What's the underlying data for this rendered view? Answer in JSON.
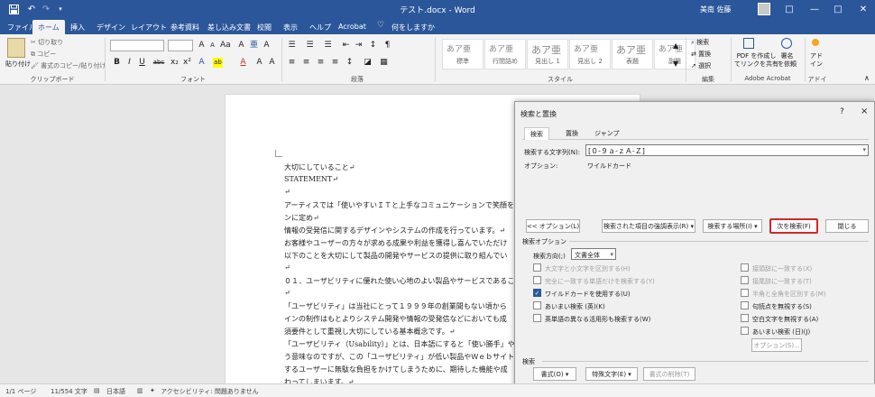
{
  "window": {
    "title": "テスト.docx - Word",
    "user": "美南 佐藤"
  },
  "qat": {
    "save_icon": "save-icon",
    "undo_icon": "undo-icon",
    "redo_icon": "redo-icon",
    "customize_icon": "chevron-down-icon"
  },
  "window_controls": {
    "ribbon_display": "□",
    "minimize": "—",
    "maximize": "□",
    "close": "✕"
  },
  "tabs": [
    {
      "label": "ファイル"
    },
    {
      "label": "ホーム",
      "active": true
    },
    {
      "label": "挿入"
    },
    {
      "label": "デザイン"
    },
    {
      "label": "レイアウト"
    },
    {
      "label": "参考資料"
    },
    {
      "label": "差し込み文書"
    },
    {
      "label": "校閲"
    },
    {
      "label": "表示"
    },
    {
      "label": "ヘルプ"
    },
    {
      "label": "Acrobat"
    },
    {
      "label": "何をしますか"
    }
  ],
  "ribbon": {
    "clipboard": {
      "label": "クリップボード",
      "paste": "貼り付け",
      "cut": "切り取り",
      "copy": "コピー",
      "format_painter": "書式のコピー/貼り付け"
    },
    "font": {
      "label": "フォント",
      "bold": "B",
      "italic": "I",
      "underline": "U",
      "strike": "abc",
      "sub": "x₂",
      "sup": "x²",
      "highlight": "ab",
      "color": "A"
    },
    "paragraph": {
      "label": "段落"
    },
    "styles": {
      "label": "スタイル",
      "items": [
        {
          "preview": "あア亜",
          "name": "標準"
        },
        {
          "preview": "あア亜",
          "name": "行間詰め"
        },
        {
          "preview": "あア亜",
          "name": "見出し 1"
        },
        {
          "preview": "あア亜",
          "name": "見出し 2"
        },
        {
          "preview": "あア亜",
          "name": "表題"
        },
        {
          "preview": "あア亜",
          "name": "副題"
        }
      ]
    },
    "editing": {
      "label": "編集",
      "find": "検索",
      "replace": "置換",
      "select": "選択"
    },
    "acrobat": {
      "label": "Adobe Acrobat",
      "create_pdf": "PDF を作成し\nてリンクを共有",
      "sign": "署名\nを依頼"
    },
    "addin": {
      "label": "アドイン",
      "addin": "アド\nイン"
    }
  },
  "document": {
    "lines": [
      "大切にしていること↵",
      "STATEMENT↵",
      "↵",
      "アーティスでは「使いやすいＩＴと上手なコミュニケーションで笑顔を",
      "ンに定め↵",
      "情報の受発信に関するデザインやシステムの作成を行っています。↵",
      "お客様やユーザーの方々が求める成果や利益を獲得し喜んでいただけ",
      "以下のことを大切にして製品の開発やサービスの提供に取り組んでい",
      "↵",
      "０１．ユーザビリティに優れた使い心地のよい製品やサービスであるこ",
      "↵",
      "「ユーザビリティ」は当社にとって１９９９年の創業間もない頃から",
      "インの制作はもとよりシステム開発や情報の受発信などにおいても成",
      "須要件として重視し大切にしている基本概念です。↵",
      "「ユーザビリティ（Usability）」とは、日本語にすると「使い勝手」や",
      "う意味なのですが、この「ユーザビリティ」が低い製品やＷｅｂサイト",
      "するユーザーに無駄な負担をかけてしまうために、期待した機能や成",
      "わってしまいます。↵"
    ]
  },
  "dialog": {
    "title": "検索と置換",
    "help": "?",
    "close": "×",
    "tabs": [
      {
        "label": "検索",
        "active": true
      },
      {
        "label": "置換"
      },
      {
        "label": "ジャンプ"
      }
    ],
    "find_label": "検索する文字列(N):",
    "find_value": "[０-９ａ-ｚＡ-Ｚ]",
    "options_label": "オプション:",
    "options_value": "ワイルドカード",
    "buttons": {
      "less": "<< オプション(L)",
      "highlight": "検索された項目の強調表示(R) ▾",
      "find_in": "検索する場所(I) ▾",
      "find_next": "次を検索(F)",
      "close": "閉じる"
    },
    "search_options_label": "検索オプション",
    "direction_label": "検索方向(;)",
    "direction_value": "文書全体",
    "left_options": [
      {
        "label": "大文字と小文字を区別する(H)",
        "checked": false,
        "disabled": true
      },
      {
        "label": "完全に一致する単語だけを検索する(Y)",
        "checked": false,
        "disabled": true
      },
      {
        "label": "ワイルドカードを使用する(U)",
        "checked": true,
        "disabled": false
      },
      {
        "label": "あいまい検索 (英)(K)",
        "checked": false,
        "disabled": false
      },
      {
        "label": "英単語の異なる活用形も検索する(W)",
        "checked": false,
        "disabled": false
      }
    ],
    "right_options": [
      {
        "label": "接頭辞に一致する(X)",
        "checked": false,
        "disabled": true
      },
      {
        "label": "接尾辞に一致する(T)",
        "checked": false,
        "disabled": true
      },
      {
        "label": "半角と全角を区別する(M)",
        "checked": false,
        "disabled": true
      },
      {
        "label": "句読点を無視する(S)",
        "checked": false,
        "disabled": false
      },
      {
        "label": "空白文字を無視する(A)",
        "checked": false,
        "disabled": false
      },
      {
        "label": "あいまい検索 (日)(J)",
        "checked": false,
        "disabled": false
      }
    ],
    "fuzzy_options_button": "オプション(S)...",
    "search_section_label": "検索",
    "format_button": "書式(O) ▾",
    "special_button": "特殊文字(E) ▾",
    "no_formatting_button": "書式の削除(T)"
  },
  "status": {
    "page": "1/1 ページ",
    "words": "11/554 文字",
    "language": "日本語",
    "accessibility": "アクセシビリティ: 問題ありません"
  },
  "colors": {
    "brand": "#2b579a",
    "accent_red": "#d0282c"
  }
}
